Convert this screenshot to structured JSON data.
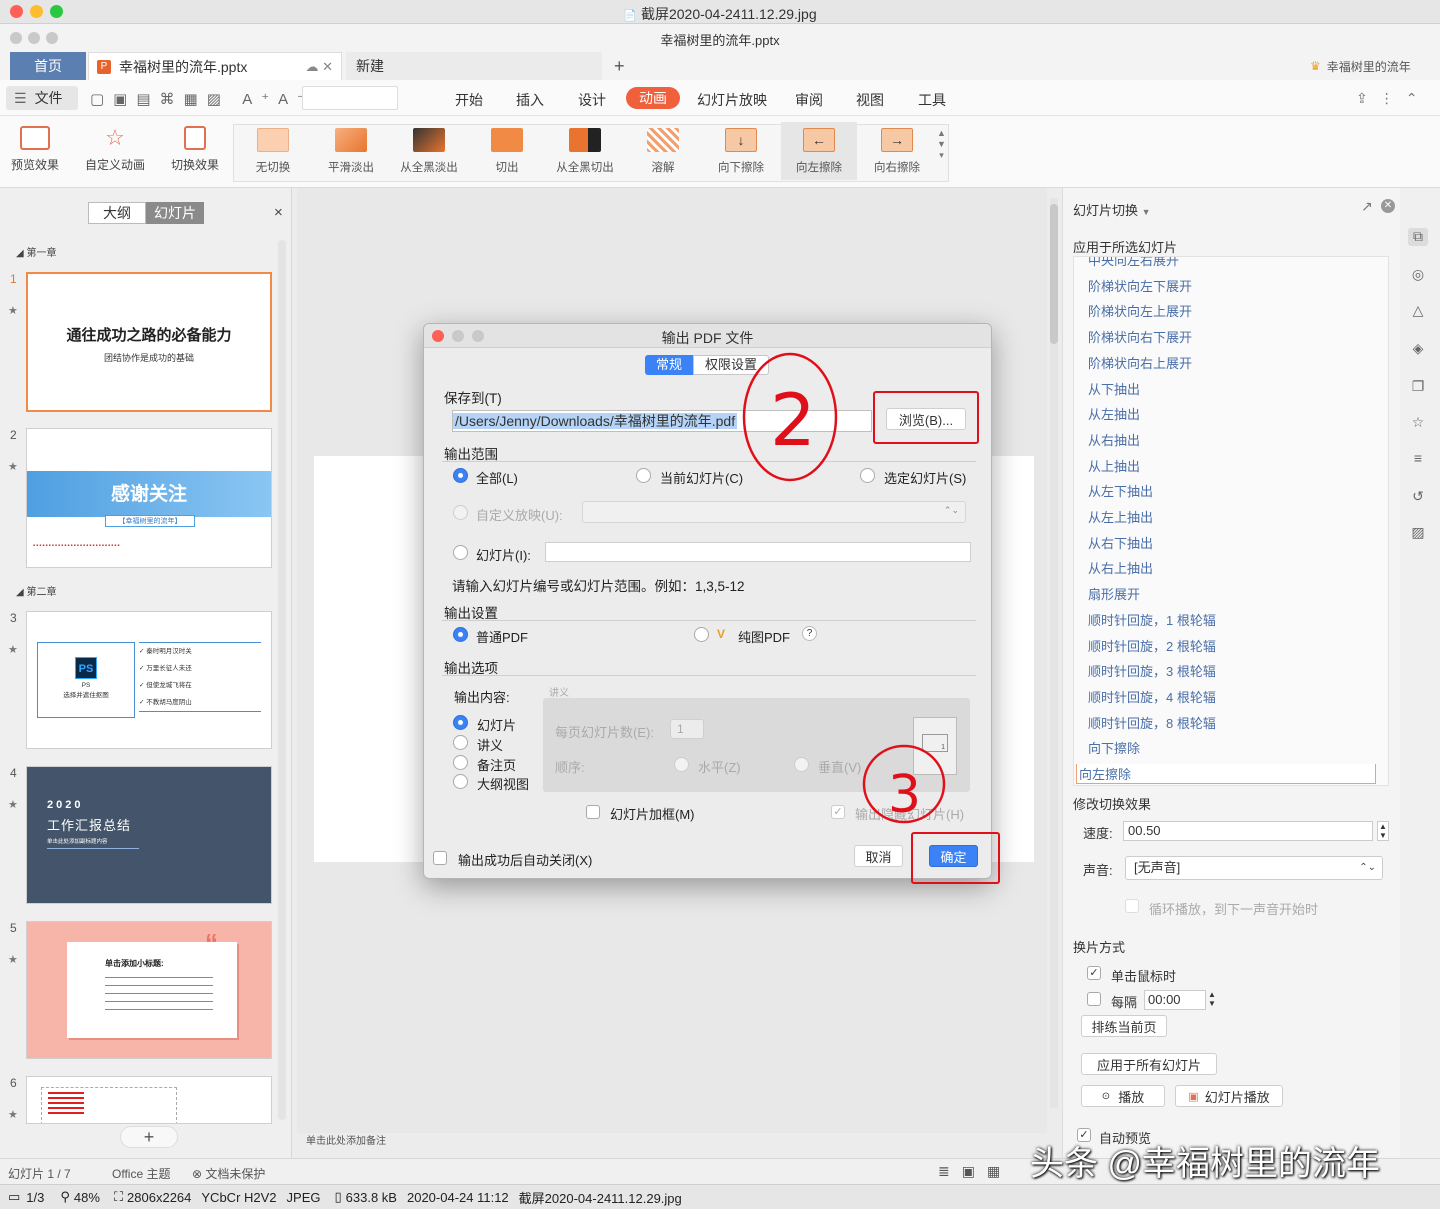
{
  "viewer": {
    "title": "截屏2020-04-2411.12.29.jpg",
    "status": {
      "page": "1/3",
      "zoom": "48%",
      "dims": "2806x2264",
      "colorspace": "YCbCr H2V2",
      "format": "JPEG",
      "size": "633.8 kB",
      "datetime": "2020-04-24 11:12",
      "filename": "截屏2020-04-2411.12.29.jpg"
    }
  },
  "app": {
    "title": "幸福树里的流年.pptx",
    "tabs": {
      "home": "首页",
      "doc": "幸福树里的流年.pptx",
      "new": "新建",
      "plus": "+"
    },
    "user": "幸福树里的流年",
    "menu": {
      "file": "文件",
      "items": [
        "开始",
        "插入",
        "设计",
        "动画",
        "幻灯片放映",
        "审阅",
        "视图",
        "工具"
      ],
      "active_index": 3
    }
  },
  "ribbon": {
    "left": [
      "预览效果",
      "自定义动画",
      "切换效果"
    ],
    "transitions": [
      "无切换",
      "平滑淡出",
      "从全黑淡出",
      "切出",
      "从全黑切出",
      "溶解",
      "向下擦除",
      "向左擦除",
      "向右擦除"
    ]
  },
  "left_panel": {
    "seg_outline": "大纲",
    "seg_slides": "幻灯片",
    "close": "×",
    "section1": "第一章",
    "section2": "第二章",
    "slides": [
      {
        "num": "1",
        "title": "通往成功之路的必备能力",
        "subtitle": "团结协作是成功的基础"
      },
      {
        "num": "2",
        "title": "感谢关注",
        "subtitle": "【幸福树里的流年】"
      },
      {
        "num": "3",
        "ps_label": "PS",
        "ps_caption": "PS\n选择并遮住抠图",
        "bullets": [
          "秦时明月汉时关",
          "万里长征人未还",
          "但使龙城飞将在",
          "不教胡马度阴山"
        ]
      },
      {
        "num": "4",
        "year": "2020",
        "title": "工作汇报总结",
        "subtitle": "单击此处添加副标题内容"
      },
      {
        "num": "5",
        "heading": "单击添加小标题:"
      },
      {
        "num": "6"
      }
    ],
    "add": "+"
  },
  "canvas": {
    "notes_hint": "单击此处添加备注"
  },
  "dialog": {
    "title": "输出 PDF 文件",
    "tabs": {
      "general": "常规",
      "permissions": "权限设置"
    },
    "save_to_label": "保存到(T)",
    "path": "/Users/Jenny/Downloads/幸福树里的流年.pdf",
    "browse": "浏览(B)...",
    "range_title": "输出范围",
    "range_all": "全部(L)",
    "range_current": "当前幻灯片(C)",
    "range_selected": "选定幻灯片(S)",
    "custom_show": "自定义放映(U):",
    "slides_label": "幻灯片(I):",
    "range_hint": "请输入幻灯片编号或幻灯片范围。例如：1,3,5-12",
    "settings_title": "输出设置",
    "normal_pdf": "普通PDF",
    "image_pdf": "纯图PDF",
    "help": "?",
    "options_title": "输出选项",
    "content_label": "输出内容:",
    "handout_group": "讲义",
    "content_options": [
      "幻灯片",
      "讲义",
      "备注页",
      "大纲视图"
    ],
    "per_page_label": "每页幻灯片数(E):",
    "per_page_value": "1",
    "order_label": "顺序:",
    "order_h": "水平(Z)",
    "order_v": "垂直(V)",
    "frame": "幻灯片加框(M)",
    "hidden": "输出隐藏幻灯片(H)",
    "auto_close": "输出成功后自动关闭(X)",
    "cancel": "取消",
    "ok": "确定",
    "preview_page": "1"
  },
  "annotations": [
    "2",
    "3"
  ],
  "right_panel": {
    "title": "幻灯片切换",
    "apply_selected": "应用于所选幻灯片",
    "effects": [
      "中央向左右展开",
      "阶梯状向左下展开",
      "阶梯状向左上展开",
      "阶梯状向右下展开",
      "阶梯状向右上展开",
      "从下抽出",
      "从左抽出",
      "从右抽出",
      "从上抽出",
      "从左下抽出",
      "从左上抽出",
      "从右下抽出",
      "从右上抽出",
      "扇形展开",
      "顺时针回旋，1 根轮辐",
      "顺时针回旋，2 根轮辐",
      "顺时针回旋，3 根轮辐",
      "顺时针回旋，4 根轮辐",
      "顺时针回旋，8 根轮辐",
      "向下擦除",
      "向左擦除"
    ],
    "selected_effect": "向左擦除",
    "modify_title": "修改切换效果",
    "speed_label": "速度:",
    "speed_value": "00.50",
    "sound_label": "声音:",
    "sound_value": "[无声音]",
    "loop_label": "循环播放，到下一声音开始时",
    "advance_title": "换片方式",
    "on_click": "单击鼠标时",
    "every": "每隔",
    "every_value": "00:00",
    "rehearse": "排练当前页",
    "apply_all": "应用于所有幻灯片",
    "play": "播放",
    "slideshow": "幻灯片播放",
    "auto_preview": "自动预览"
  },
  "statusbar": {
    "slide_count": "幻灯片 1 / 7",
    "theme": "Office 主题",
    "protect": "文档未保护"
  },
  "watermark": "头条 @幸福树里的流年"
}
